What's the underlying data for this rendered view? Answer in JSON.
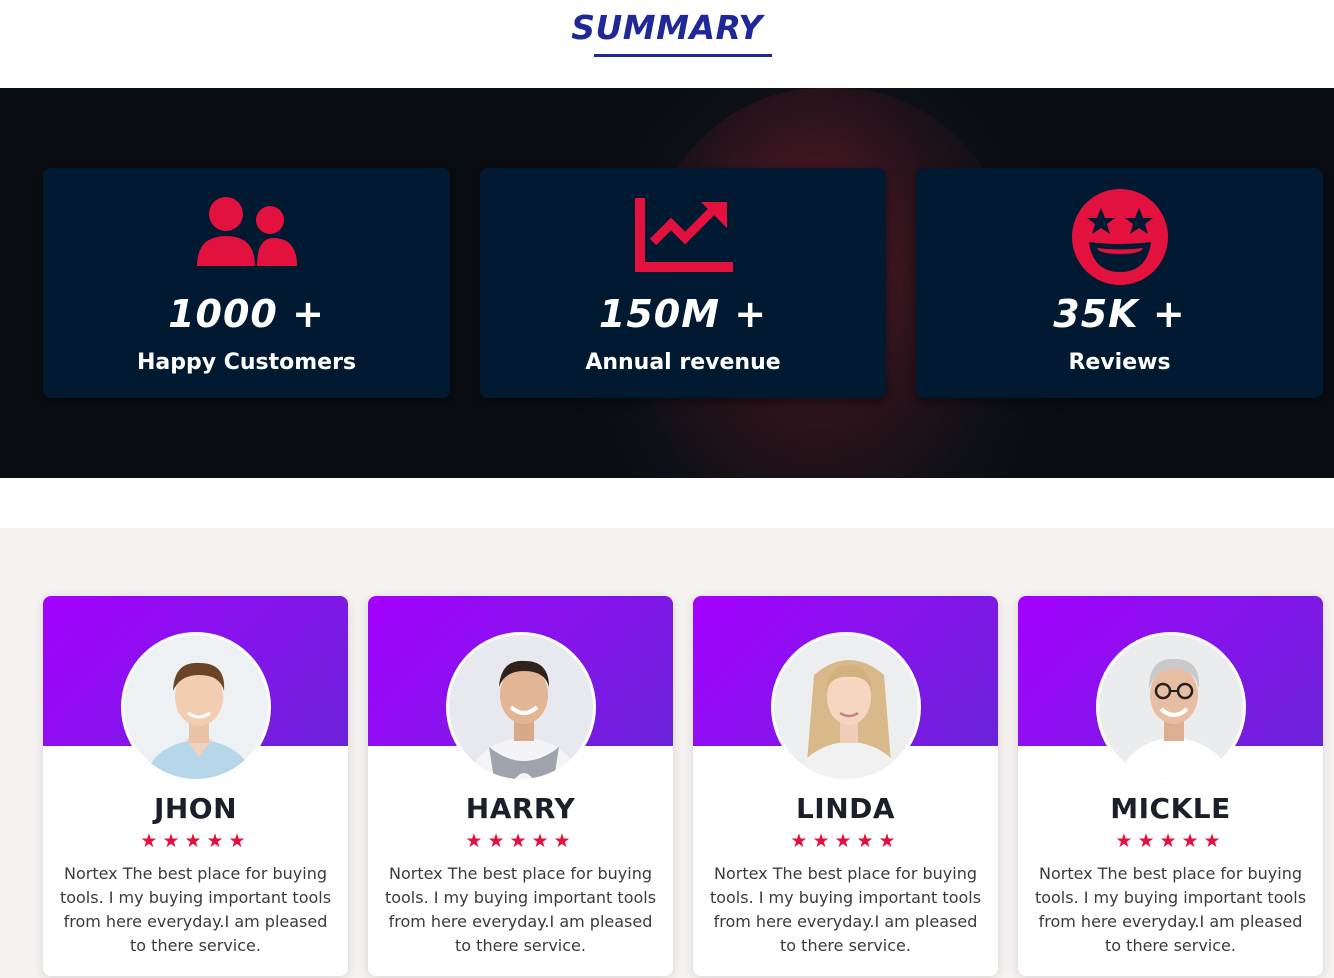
{
  "summary": {
    "title": "SUMMARY"
  },
  "stats": [
    {
      "icon": "users-icon",
      "value": "1000 +",
      "label": "Happy Customers"
    },
    {
      "icon": "trending-up-chart-icon",
      "value": "150M +",
      "label": "Annual revenue"
    },
    {
      "icon": "star-struck-face-icon",
      "value": "35K +",
      "label": "Reviews"
    }
  ],
  "testimonials": [
    {
      "name": "JHON",
      "stars": "★★★★★",
      "rating": 5,
      "text": "Nortex The best place for buying tools. I my buying important tools from here everyday.I am pleased to there service."
    },
    {
      "name": "HARRY",
      "stars": "★★★★★",
      "rating": 5,
      "text": "Nortex The best place for buying tools. I my buying important tools from here everyday.I am pleased to there service."
    },
    {
      "name": "LINDA",
      "stars": "★★★★★",
      "rating": 5,
      "text": "Nortex The best place for buying tools. I my buying important tools from here everyday.I am pleased to there service."
    },
    {
      "name": "MICKLE",
      "stars": "★★★★★",
      "rating": 5,
      "text": "Nortex The best place for buying tools. I my buying important tools from here everyday.I am pleased to there service."
    }
  ],
  "colors": {
    "accent": "#e3113d",
    "title_blue": "#1f2896",
    "stat_card": "#021a31",
    "banner_start": "#a400ff",
    "banner_end": "#6a22d8"
  }
}
